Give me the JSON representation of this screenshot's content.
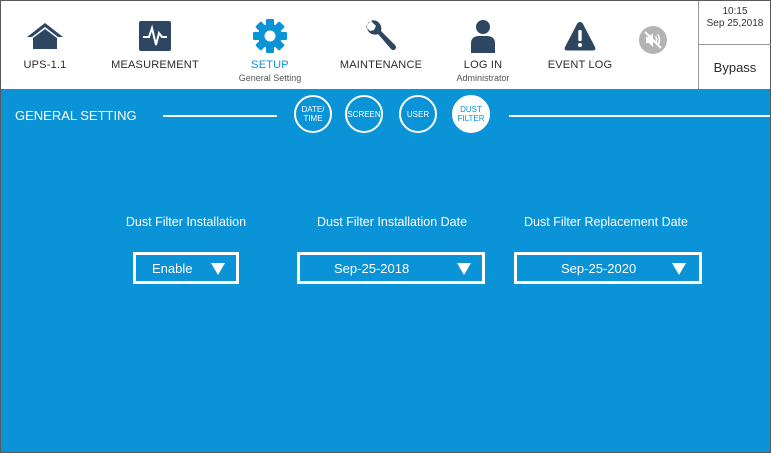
{
  "nav": {
    "items": [
      {
        "label": "UPS-1.1",
        "sub": "",
        "icon": "home-icon"
      },
      {
        "label": "MEASUREMENT",
        "sub": "",
        "icon": "waveform-icon"
      },
      {
        "label": "SETUP",
        "sub": "General Setting",
        "icon": "gear-icon"
      },
      {
        "label": "MAINTENANCE",
        "sub": "",
        "icon": "wrench-icon"
      },
      {
        "label": "LOG IN",
        "sub": "Administrator",
        "icon": "user-icon"
      },
      {
        "label": "EVENT LOG",
        "sub": "",
        "icon": "warning-icon"
      }
    ],
    "mute_icon": "mute-icon"
  },
  "status": {
    "time": "10:15",
    "date": "Sep 25,2018",
    "mode": "Bypass"
  },
  "main": {
    "title": "GENERAL SETTING",
    "tabs": [
      {
        "line1": "DATE/",
        "line2": "TIME"
      },
      {
        "line1": "SCREEN",
        "line2": ""
      },
      {
        "line1": "USER",
        "line2": ""
      },
      {
        "line1": "DUST",
        "line2": "FILTER"
      }
    ],
    "fields": [
      {
        "label": "Dust Filter Installation",
        "value": "Enable"
      },
      {
        "label": "Dust Filter Installation Date",
        "value": "Sep-25-2018"
      },
      {
        "label": "Dust Filter Replacement Date",
        "value": "Sep-25-2020"
      }
    ]
  },
  "colors": {
    "accent": "#0a93d6",
    "icon": "#2d4763"
  }
}
